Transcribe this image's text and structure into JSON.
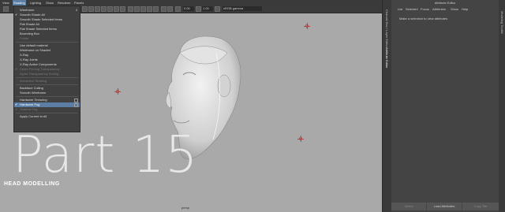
{
  "menubar": {
    "items": [
      "View",
      "Shading",
      "Lighting",
      "Show",
      "Renderer",
      "Panels"
    ],
    "active_index": 1
  },
  "toolbar": {
    "value1": "0.00",
    "value2": "1.00",
    "colorspace": "sRGB gamma"
  },
  "dropdown": {
    "items": [
      {
        "label": "Wireframe",
        "checked": false,
        "dim": false,
        "highlight": false,
        "box": false,
        "hotkey": "4"
      },
      {
        "label": "Smooth Shade All",
        "checked": true,
        "dim": false,
        "highlight": false,
        "box": false,
        "hotkey": ""
      },
      {
        "label": "Smooth Shade Selected Items",
        "checked": false,
        "dim": false,
        "highlight": false,
        "box": false,
        "hotkey": ""
      },
      {
        "label": "Flat Shade All",
        "checked": false,
        "dim": false,
        "highlight": false,
        "box": false,
        "hotkey": ""
      },
      {
        "label": "Flat Shade Selected Items",
        "checked": false,
        "dim": false,
        "highlight": false,
        "box": false,
        "hotkey": ""
      },
      {
        "label": "Bounding Box",
        "checked": false,
        "dim": false,
        "highlight": false,
        "box": false,
        "hotkey": ""
      },
      {
        "label": "Points",
        "checked": false,
        "dim": true,
        "highlight": false,
        "box": false,
        "hotkey": ""
      },
      {
        "sep": true
      },
      {
        "label": "Use default material",
        "checked": false,
        "dim": false,
        "highlight": false,
        "box": false,
        "hotkey": ""
      },
      {
        "label": "Wireframe on Shaded",
        "checked": false,
        "dim": false,
        "highlight": false,
        "box": false,
        "hotkey": ""
      },
      {
        "label": "X-Ray",
        "checked": false,
        "dim": false,
        "highlight": false,
        "box": false,
        "hotkey": ""
      },
      {
        "label": "X-Ray Joints",
        "checked": false,
        "dim": false,
        "highlight": false,
        "box": false,
        "hotkey": ""
      },
      {
        "label": "X-Ray Active Components",
        "checked": false,
        "dim": false,
        "highlight": false,
        "box": false,
        "hotkey": ""
      },
      {
        "label": "Depth Peeling Transparency",
        "checked": true,
        "dim": true,
        "highlight": false,
        "box": false,
        "hotkey": ""
      },
      {
        "label": "Alpha Transparency Sorting",
        "checked": false,
        "dim": true,
        "highlight": false,
        "box": false,
        "hotkey": ""
      },
      {
        "sep": true
      },
      {
        "label": "Interactive Shading",
        "checked": false,
        "dim": true,
        "highlight": false,
        "box": false,
        "hotkey": ""
      },
      {
        "sep": true
      },
      {
        "label": "Backface Culling",
        "checked": false,
        "dim": false,
        "highlight": false,
        "box": false,
        "hotkey": ""
      },
      {
        "label": "Smooth Wireframe",
        "checked": false,
        "dim": false,
        "highlight": false,
        "box": false,
        "hotkey": ""
      },
      {
        "sep": true
      },
      {
        "label": "Hardware Texturing",
        "checked": false,
        "dim": false,
        "highlight": false,
        "box": true,
        "hotkey": ""
      },
      {
        "label": "Hardware Fog",
        "checked": true,
        "dim": false,
        "highlight": true,
        "box": true,
        "hotkey": ""
      },
      {
        "label": "Shadow Fog",
        "checked": true,
        "dim": true,
        "highlight": false,
        "box": false,
        "hotkey": ""
      },
      {
        "sep": true
      },
      {
        "label": "Apply Current to All",
        "checked": false,
        "dim": false,
        "highlight": false,
        "box": false,
        "hotkey": ""
      }
    ]
  },
  "overlay": {
    "title": "Part 15",
    "subtitle": "HEAD MODELLING",
    "camera_label": "persp"
  },
  "side_tabs": [
    "Channel Box / Layer Editor",
    "Attribute Editor",
    "Modeling Toolkit"
  ],
  "attribute_editor": {
    "title": "Attribute Editor",
    "menu": [
      "List",
      "Selected",
      "Focus",
      "Attributes",
      "Show",
      "Help"
    ],
    "message": "Make a selection to view attributes",
    "buttons": [
      "Select",
      "Load Attributes",
      "Copy Tab"
    ]
  },
  "colors": {
    "menu_highlight": "#5d7ea4",
    "viewport_bg": "#a9a9a9",
    "locator": "#b34a4a"
  }
}
